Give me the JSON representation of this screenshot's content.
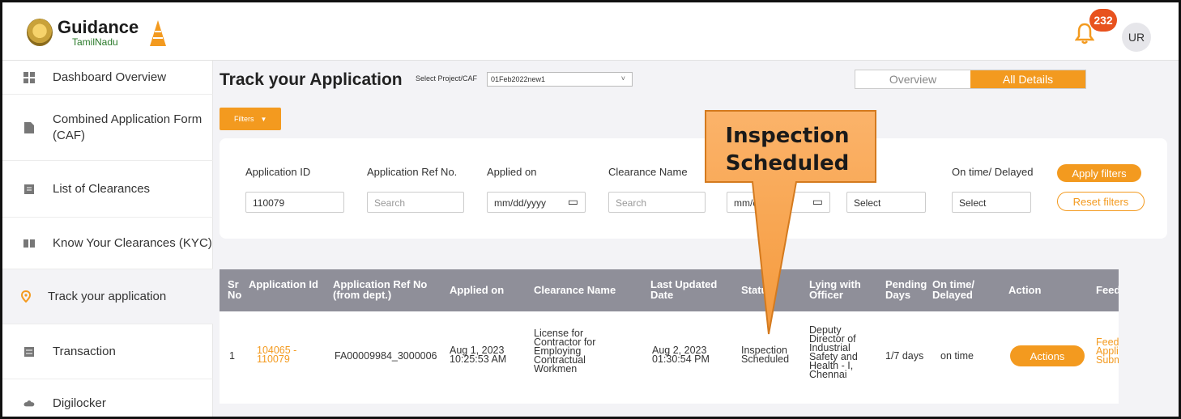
{
  "header": {
    "brand": "Guidance",
    "brand_sub": "TamilNadu",
    "notification_count": "232",
    "user_initials": "UR"
  },
  "sidebar": {
    "items": [
      {
        "label": "Dashboard Overview",
        "icon": "dashboard-icon"
      },
      {
        "label": "Combined Application Form (CAF)",
        "icon": "document-icon"
      },
      {
        "label": "List of Clearances",
        "icon": "list-icon"
      },
      {
        "label": "Know Your Clearances (KYC)",
        "icon": "book-icon"
      },
      {
        "label": "Track your application",
        "icon": "location-pin-icon"
      },
      {
        "label": "Transaction",
        "icon": "card-icon"
      },
      {
        "label": "Digilocker",
        "icon": "cloud-icon"
      }
    ]
  },
  "main": {
    "title": "Track your Application",
    "select_label": "Select Project/CAF",
    "select_value": "01Feb2022new1",
    "tabs": [
      "Overview",
      "All Details"
    ],
    "filters_label": "Filters",
    "filters": {
      "application_id_label": "Application ID",
      "application_id_value": "110079",
      "ref_no_label": "Application Ref No.",
      "ref_no_placeholder": "Search",
      "applied_on_label": "Applied on",
      "applied_on_placeholder": "mm/dd/yyyy",
      "clearance_name_label": "Clearance Name",
      "clearance_name_placeholder": "Search",
      "last_updated_placeholder": "mm/dd/yyyy",
      "status_placeholder": "Select",
      "ontime_label": "On time/ Delayed",
      "ontime_placeholder": "Select",
      "apply_label": "Apply filters",
      "reset_label": "Reset filters"
    }
  },
  "table": {
    "headers": [
      "Sr No",
      "Application Id",
      "Application Ref No (from dept.)",
      "Applied on",
      "Clearance Name",
      "Last Updated Date",
      "Status",
      "Lying with Officer",
      "Pending Days",
      "On time/ Delayed",
      "Action",
      "Feedback"
    ],
    "row": {
      "sr": "1",
      "app_id": "104065 - 110079",
      "ref_no": "FA00009984_3000006",
      "applied_on": "Aug 1, 2023 10:25:53 AM",
      "clearance_name": "License for Contractor for Employing Contractual Workmen",
      "last_updated": "Aug 2, 2023 01:30:54 PM",
      "status": "Inspection Scheduled",
      "officer": "Deputy Director of Industrial Safety and Health - I, Chennai",
      "pending_days": "1/7 days",
      "ontime": "on time",
      "action": "Actions",
      "feedback": "Feedback Application Submitted"
    }
  },
  "callout": {
    "text": "Inspection Scheduled"
  },
  "colors": {
    "accent": "#f39a1f",
    "header_bg": "#8f8f99",
    "badge": "#e8521e"
  }
}
